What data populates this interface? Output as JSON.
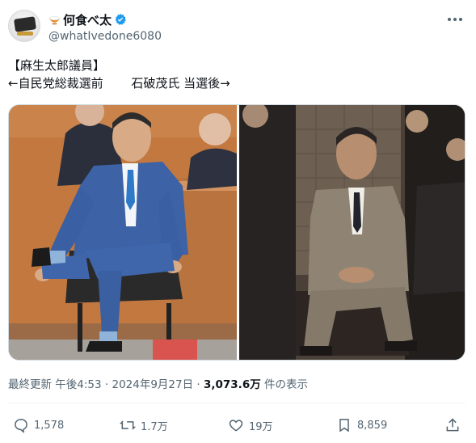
{
  "user": {
    "display_name": "何食べ太",
    "handle": "@whatIvedone6080",
    "verified_icon": "verified-badge-icon",
    "bowl_emoji_icon": "rice-bowl-icon"
  },
  "tweet": {
    "line1": "【麻生太郎議員】",
    "line2": "←自民党総裁選前　　 石破茂氏 当選後→"
  },
  "media": {
    "left_photo_icon": "photo-seated-man-blue-suit",
    "right_photo_icon": "photo-seated-man-grey-suit"
  },
  "meta": {
    "updated_label": "最終更新 午後4:53 · 2024年9月27日 ·",
    "views_count": "3,073.6万",
    "views_label": "件の表示"
  },
  "actions": {
    "replies": "1,578",
    "retweets": "1.7万",
    "likes": "19万",
    "bookmarks": "8,859"
  },
  "colors": {
    "text": "#0f1419",
    "secondary": "#536471",
    "verified": "#1d9bf0",
    "border": "#cfd9de"
  }
}
